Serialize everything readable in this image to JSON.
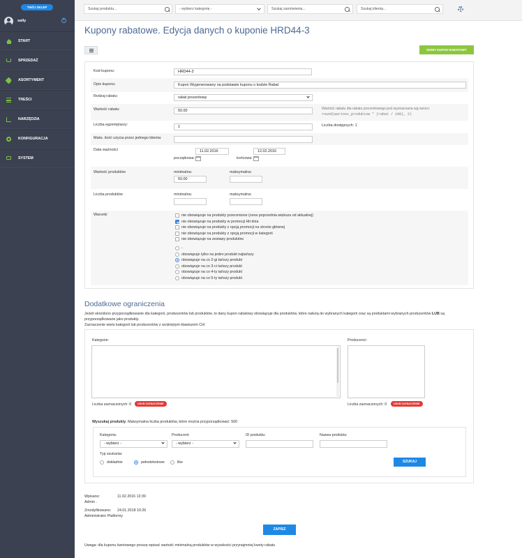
{
  "sidebar": {
    "shop_button": "TWÓJ SKLEP",
    "username": "sally",
    "items": [
      {
        "label": "START",
        "icon": "home-icon"
      },
      {
        "label": "SPRZEDAŻ",
        "icon": "cart-icon"
      },
      {
        "label": "ASORTYMENT",
        "icon": "tag-icon"
      },
      {
        "label": "TREŚCI",
        "icon": "content-icon"
      },
      {
        "label": "NARZĘDZIA",
        "icon": "chart-icon"
      },
      {
        "label": "KONFIGURACJA",
        "icon": "gear-icon"
      },
      {
        "label": "SYSTEM",
        "icon": "monitor-icon"
      }
    ]
  },
  "topbar": {
    "search_product": "Szukaj produktu...",
    "category_select": "- wybierz kategorię -",
    "search_order": "Szukaj zamówienia...",
    "search_client": "Szukaj klienta..."
  },
  "page": {
    "title": "Kupony rabatowe. Edycja danych o kuponie HRD44-3",
    "new_coupon_button": "NOWY KUPON RABATOWY"
  },
  "form": {
    "code_label": "Kod kuponu:",
    "code_value": "HRD44-3",
    "desc_label": "Opis kuponu:",
    "desc_value": "Kupon Wygenerowany na podstawie kuponu o kodzie Rabat",
    "type_label": "Rodzaj rabatu:",
    "type_value": "rabat procentowy",
    "value_label": "Wartość rabatu:",
    "value_value": "50.00",
    "value_note_1": "Wartość rabatu dla rabatu procentowego jest wyznaczana wg wzoru:",
    "value_note_2": "round(wartosc_produktow * (rabat / 100), 2)",
    "copies_label": "Liczba egzemplarzy:",
    "copies_value": "1",
    "available_text": "Liczba dostępnych: 1",
    "max_uses_label": "Maks. ilość użycia przez jednego klienta:",
    "max_uses_value": "",
    "validity_label": "Data ważności",
    "start_label": "początkowa:",
    "start_value": "11.02.2016",
    "end_label": "końcowa:",
    "end_value": "12.02.2016",
    "products_value_label": "Wartość produktów",
    "min_label": "minimalna:",
    "max_label": "maksymalna:",
    "products_min_value": "50.00",
    "products_max_value": "",
    "products_count_label": "Liczba produktów",
    "count_min_label": "minimalna:",
    "count_max_label": "maksymalna:",
    "conditions_label": "Warunki",
    "checkboxes": [
      {
        "label": "nie obowiązuje na produkty przecenione (cena poprzednia większa od aktualnej)",
        "checked": false
      },
      {
        "label": "nie obowiązuje na produkty w promocji Hit dnia",
        "checked": true
      },
      {
        "label": "nie obowiązuje na produkty z opcją promocji na stronie głównej",
        "checked": false
      },
      {
        "label": "nie obowiązuje na produkty z opcją promocji w kategorii",
        "checked": false
      },
      {
        "label": "nie obowiązuje na zestawy produktów",
        "checked": false
      }
    ],
    "radios": [
      {
        "label": "-",
        "checked": false
      },
      {
        "label": "obowiązuje tylko na jeden produkt najtańszy",
        "checked": false
      },
      {
        "label": "obowiązuje na co 2-gi tańszy produkt",
        "checked": true
      },
      {
        "label": "obowiązuje na co 3-ci tańszy produkt",
        "checked": false
      },
      {
        "label": "obowiązuje na co 4-ty tańszy produkt",
        "checked": false
      },
      {
        "label": "obowiązuje na co 5-ty tańszy produkt",
        "checked": false
      }
    ]
  },
  "extra": {
    "title": "Dodatkowe ograniczenia",
    "para_1a": "Jeżeli określono przyporządkowanie dla kategorii, producentów lub produktów, to dany kupon rabatowy obowiązuje dla produktów, które należą do wybranych kategorii oraz są produktami wybranych producentów",
    "para_1b": "LUB",
    "para_1c": "są",
    "para_2": "przyporządkowane jako produkty.",
    "para_3": "Zaznaczenie wielu kategorii lub producentów z wciśniętym klawiszem Ctrl",
    "categories_label": "Kategorie:",
    "producers_label": "Producenci:",
    "selected_count_label": "Liczba zaznaczonych: 0",
    "clear_button": "USUŃ ZAZNACZENIE",
    "search_products_bold": "Wyszukaj produkty",
    "search_products_rest": ". Maksymalna liczba produktów, które można przyporządkować: 500",
    "category_field_label": "Kategoria:",
    "category_field_value": "- wybierz -",
    "producer_field_label": "Producent:",
    "producer_field_value": "- wybierz -",
    "id_field_label": "ID produktu:",
    "name_field_label": "Nazwa produktu:",
    "search_type_label": "Typ szukania:",
    "search_types": [
      {
        "label": "dokładnie",
        "checked": false
      },
      {
        "label": "pełnotekstowe",
        "checked": true
      },
      {
        "label": "like",
        "checked": false
      }
    ],
    "search_button": "SZUKAJ"
  },
  "meta": {
    "created_label": "Wpisano:",
    "created_value": "11.02.2016 13:39",
    "created_by": "Admin .",
    "modified_label": "Zmodyfikowano:",
    "modified_value": "24.01.2018 10:26",
    "modified_by": "Administrator Platformy",
    "save_button": "ZAPISZ",
    "footnote": "Uwaga: dla kuponu kwotowego proszę wpisać wartość minimalną produktów w wysokości przynajmniej kwoty rabatu"
  },
  "colors": {
    "sidebar": "#3b4150",
    "accent_green": "#8cc63f",
    "accent_blue": "#1e88e5",
    "title_blue": "#4b6a93",
    "danger_red": "#e53935"
  }
}
